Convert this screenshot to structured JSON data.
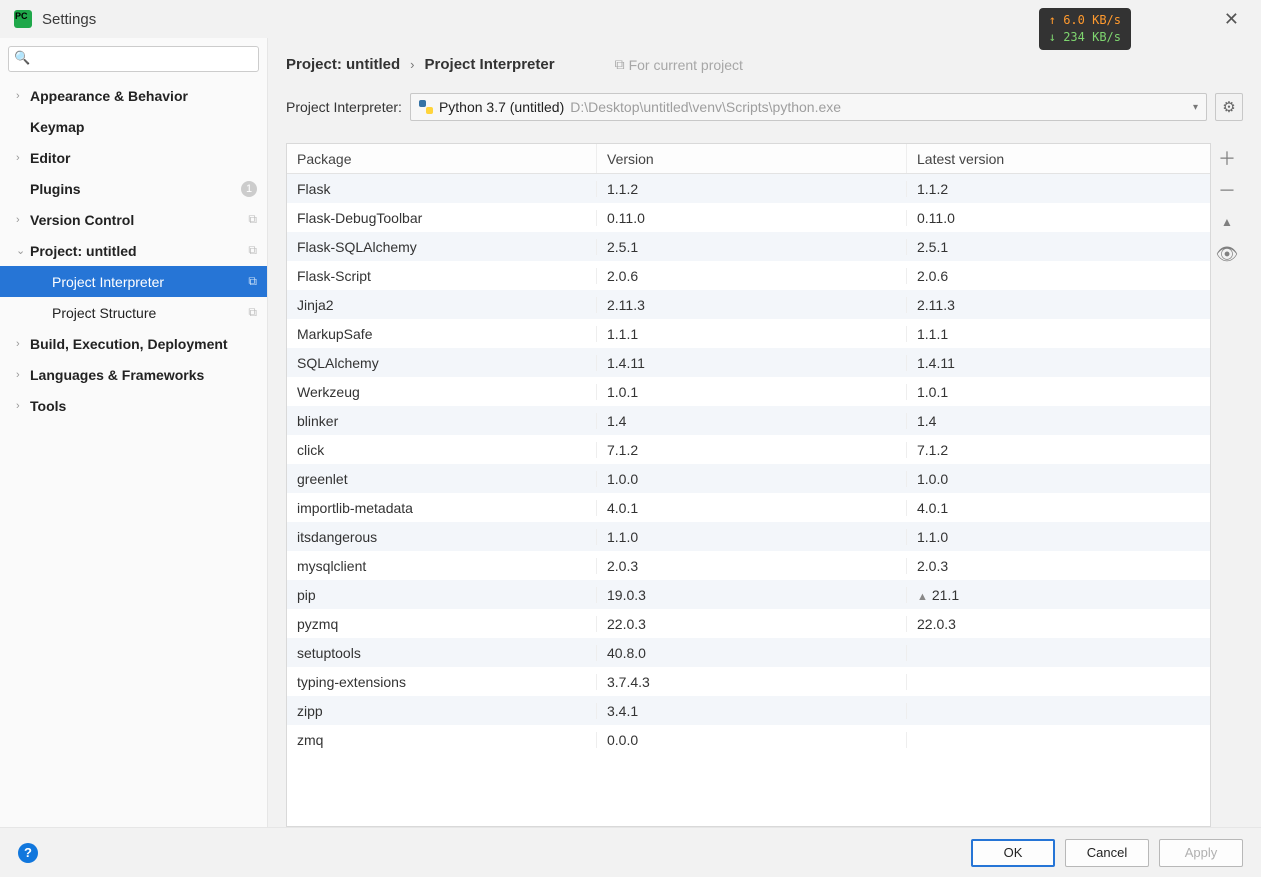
{
  "window": {
    "title": "Settings"
  },
  "net": {
    "up": "↑ 6.0 KB/s",
    "down": "↓ 234 KB/s"
  },
  "search": {
    "placeholder": ""
  },
  "sidebar": {
    "items": [
      {
        "label": "Appearance & Behavior",
        "chev": "›",
        "bold": true
      },
      {
        "label": "Keymap",
        "chev": "",
        "bold": true
      },
      {
        "label": "Editor",
        "chev": "›",
        "bold": true
      },
      {
        "label": "Plugins",
        "chev": "",
        "bold": true,
        "badge": "1"
      },
      {
        "label": "Version Control",
        "chev": "›",
        "bold": true,
        "copy": true
      },
      {
        "label": "Project: untitled",
        "chev": "⌄",
        "bold": true,
        "copy": true,
        "expanded": true
      },
      {
        "label": "Project Interpreter",
        "child": true,
        "selected": true,
        "copy": true
      },
      {
        "label": "Project Structure",
        "child": true,
        "copy": true
      },
      {
        "label": "Build, Execution, Deployment",
        "chev": "›",
        "bold": true
      },
      {
        "label": "Languages & Frameworks",
        "chev": "›",
        "bold": true
      },
      {
        "label": "Tools",
        "chev": "›",
        "bold": true
      }
    ]
  },
  "breadcrumb": {
    "project": "Project: untitled",
    "page": "Project Interpreter",
    "hint": "For current project"
  },
  "interpreter": {
    "label": "Project Interpreter:",
    "name": "Python 3.7 (untitled)",
    "path": "D:\\Desktop\\untitled\\venv\\Scripts\\python.exe"
  },
  "table": {
    "headers": {
      "pkg": "Package",
      "ver": "Version",
      "lat": "Latest version"
    },
    "rows": [
      {
        "pkg": "Flask",
        "ver": "1.1.2",
        "lat": "1.1.2"
      },
      {
        "pkg": "Flask-DebugToolbar",
        "ver": "0.11.0",
        "lat": "0.11.0"
      },
      {
        "pkg": "Flask-SQLAlchemy",
        "ver": "2.5.1",
        "lat": "2.5.1"
      },
      {
        "pkg": "Flask-Script",
        "ver": "2.0.6",
        "lat": "2.0.6"
      },
      {
        "pkg": "Jinja2",
        "ver": "2.11.3",
        "lat": "2.11.3"
      },
      {
        "pkg": "MarkupSafe",
        "ver": "1.1.1",
        "lat": "1.1.1"
      },
      {
        "pkg": "SQLAlchemy",
        "ver": "1.4.11",
        "lat": "1.4.11"
      },
      {
        "pkg": "Werkzeug",
        "ver": "1.0.1",
        "lat": "1.0.1"
      },
      {
        "pkg": "blinker",
        "ver": "1.4",
        "lat": "1.4"
      },
      {
        "pkg": "click",
        "ver": "7.1.2",
        "lat": "7.1.2"
      },
      {
        "pkg": "greenlet",
        "ver": "1.0.0",
        "lat": "1.0.0"
      },
      {
        "pkg": "importlib-metadata",
        "ver": "4.0.1",
        "lat": "4.0.1"
      },
      {
        "pkg": "itsdangerous",
        "ver": "1.1.0",
        "lat": "1.1.0"
      },
      {
        "pkg": "mysqlclient",
        "ver": "2.0.3",
        "lat": "2.0.3"
      },
      {
        "pkg": "pip",
        "ver": "19.0.3",
        "lat": "21.1",
        "upgrade": true
      },
      {
        "pkg": "pyzmq",
        "ver": "22.0.3",
        "lat": "22.0.3"
      },
      {
        "pkg": "setuptools",
        "ver": "40.8.0",
        "lat": ""
      },
      {
        "pkg": "typing-extensions",
        "ver": "3.7.4.3",
        "lat": ""
      },
      {
        "pkg": "zipp",
        "ver": "3.4.1",
        "lat": ""
      },
      {
        "pkg": "zmq",
        "ver": "0.0.0",
        "lat": ""
      }
    ]
  },
  "footer": {
    "ok": "OK",
    "cancel": "Cancel",
    "apply": "Apply"
  }
}
